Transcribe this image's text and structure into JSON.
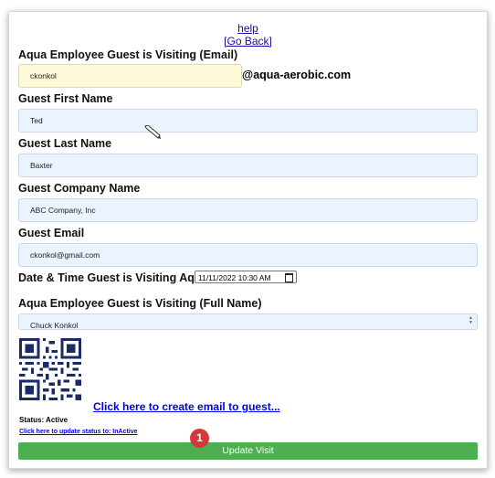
{
  "links": {
    "help": "help",
    "go_back": "[Go Back]"
  },
  "employee_email": {
    "label": "Aqua Employee Guest is Visiting (Email)",
    "value": "ckonkol",
    "domain": "@aqua-aerobic.com"
  },
  "guest_first": {
    "label": "Guest First Name",
    "value": "Ted"
  },
  "guest_last": {
    "label": "Guest Last Name",
    "value": "Baxter"
  },
  "guest_company": {
    "label": "Guest Company Name",
    "value": "ABC Company, Inc"
  },
  "guest_email": {
    "label": "Guest Email",
    "value": "ckonkol@gmail.com"
  },
  "visit_datetime": {
    "label": "Date & Time Guest is Visiting Aqua:",
    "value": "11/11/2022 10:30 AM"
  },
  "employee_full": {
    "label": "Aqua Employee Guest is Visiting (Full Name)",
    "value": "Chuck Konkol"
  },
  "email_link": "Click here to create email to guest...",
  "status": {
    "text": "Status: Active",
    "toggle_link": "Click here to update status to: InActive"
  },
  "update_button": "Update Visit",
  "step_badge": "1",
  "colors": {
    "field_bg": "#eaf3fe",
    "highlight_bg": "#fffbd8",
    "button": "#4caf50",
    "badge": "#d63838",
    "link": "#0000ee"
  },
  "icons": {
    "calendar": "calendar-icon",
    "qr": "qr-code",
    "cursor": "pen-cursor-icon"
  }
}
